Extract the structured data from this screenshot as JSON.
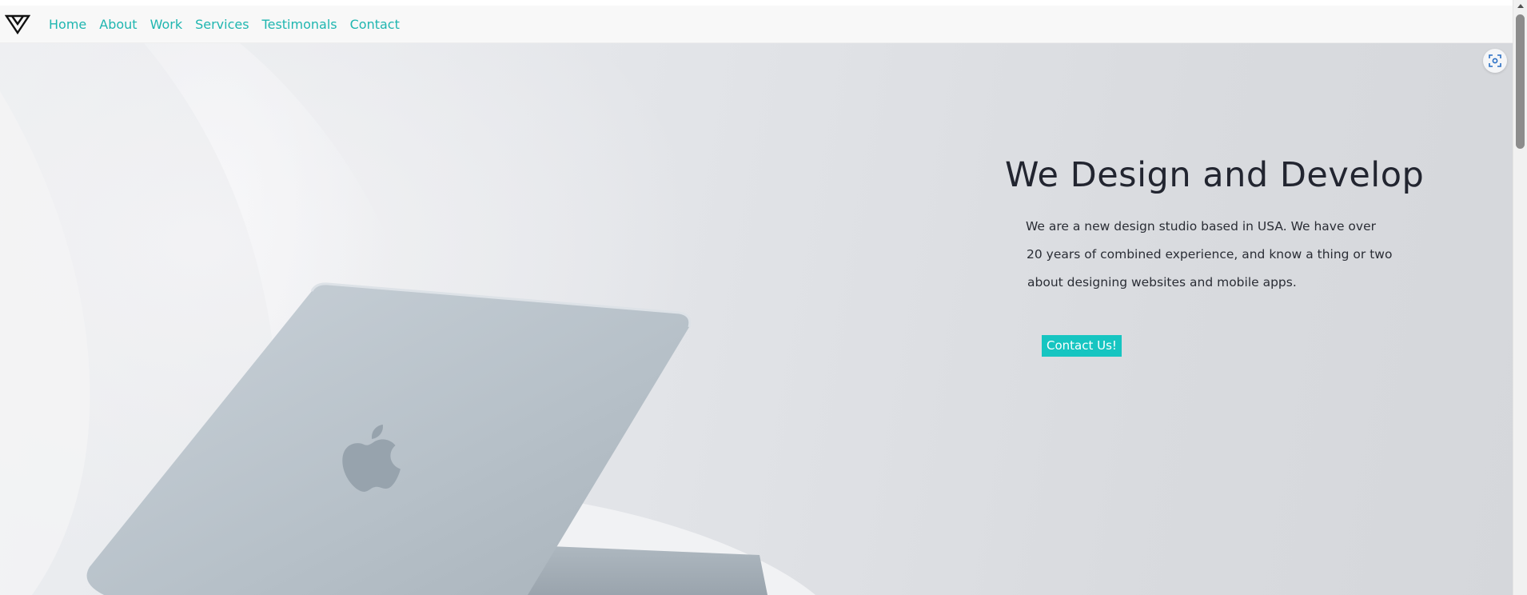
{
  "nav": {
    "logo_icon": "triangle-logo-icon",
    "links": [
      "Home",
      "About",
      "Work",
      "Services",
      "Testimonals",
      "Contact"
    ]
  },
  "hero": {
    "title": "We Design and Develop",
    "description_lines": [
      "We are a new design studio based in USA. We have over",
      "20 years of combined experience, and know a thing or two",
      "about designing websites and mobile apps."
    ],
    "cta_label": "Contact Us!"
  },
  "colors": {
    "accent": "#1fb6b0",
    "button": "#16c5c1",
    "title": "#222530"
  },
  "tools": {
    "lens_icon": "screenshot-search-icon"
  }
}
